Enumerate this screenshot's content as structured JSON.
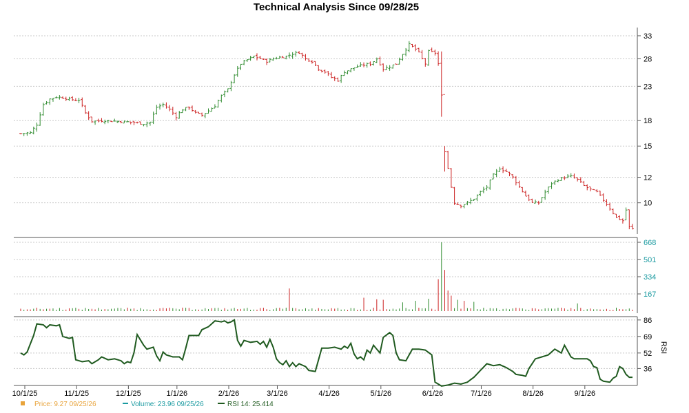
{
  "chart_data": {
    "type": "line",
    "title": "Technical Analysis Since 09/28/25",
    "colors": {
      "up": "#2e8b2e",
      "down": "#cc2222",
      "rsi": "#1f5a1f",
      "price_legend": "#e8a33a",
      "volume_legend": "#1a9aa0"
    },
    "x_tick_labels": [
      "10/1/25",
      "11/1/25",
      "12/1/25",
      "1/1/26",
      "2/1/26",
      "3/1/26",
      "4/1/26",
      "5/1/26",
      "6/1/26",
      "7/1/26",
      "8/1/26",
      "9/1/26"
    ],
    "price_panel": {
      "y_tick_labels": [
        "33",
        "28",
        "23",
        "18",
        "15",
        "12",
        "10"
      ],
      "scale": "log",
      "anchors": [
        [
          0,
          16.4
        ],
        [
          3,
          16.5
        ],
        [
          5,
          17.5
        ],
        [
          7,
          20.2
        ],
        [
          9,
          21.0
        ],
        [
          11,
          21.3
        ],
        [
          13,
          21.2
        ],
        [
          15,
          21.0
        ],
        [
          17,
          20.8
        ],
        [
          18,
          20.9
        ],
        [
          20,
          19.0
        ],
        [
          22,
          17.9
        ],
        [
          26,
          18.0
        ],
        [
          30,
          17.9
        ],
        [
          34,
          17.8
        ],
        [
          38,
          17.6
        ],
        [
          40,
          17.8
        ],
        [
          42,
          19.8
        ],
        [
          44,
          20.2
        ],
        [
          46,
          19.5
        ],
        [
          48,
          18.5
        ],
        [
          50,
          19.5
        ],
        [
          52,
          19.8
        ],
        [
          54,
          19.0
        ],
        [
          56,
          18.7
        ],
        [
          58,
          19.3
        ],
        [
          60,
          20.0
        ],
        [
          62,
          21.5
        ],
        [
          64,
          22.5
        ],
        [
          66,
          25.0
        ],
        [
          68,
          27.0
        ],
        [
          70,
          27.8
        ],
        [
          72,
          28.5
        ],
        [
          74,
          28.0
        ],
        [
          76,
          27.5
        ],
        [
          78,
          28.0
        ],
        [
          80,
          28.3
        ],
        [
          82,
          28.5
        ],
        [
          84,
          29.0
        ],
        [
          86,
          29.3
        ],
        [
          88,
          28.0
        ],
        [
          90,
          27.5
        ],
        [
          92,
          26.0
        ],
        [
          94,
          25.5
        ],
        [
          96,
          24.5
        ],
        [
          98,
          24.0
        ],
        [
          100,
          25.5
        ],
        [
          102,
          26.0
        ],
        [
          104,
          26.5
        ],
        [
          106,
          26.8
        ],
        [
          108,
          27.0
        ],
        [
          110,
          28.0
        ],
        [
          112,
          26.0
        ],
        [
          114,
          26.5
        ],
        [
          116,
          27.0
        ],
        [
          118,
          29.0
        ],
        [
          120,
          31.0
        ],
        [
          122,
          30.0
        ],
        [
          123,
          29.2
        ],
        [
          124,
          28.0
        ],
        [
          125,
          27.0
        ],
        [
          126,
          29.5
        ],
        [
          128,
          29.2
        ],
        [
          129,
          27.0
        ],
        [
          130,
          21.5
        ],
        [
          131,
          14.5
        ],
        [
          132,
          12.8
        ],
        [
          133,
          11.2
        ],
        [
          134,
          10.0
        ],
        [
          136,
          9.8
        ],
        [
          138,
          10.0
        ],
        [
          140,
          10.3
        ],
        [
          142,
          10.8
        ],
        [
          144,
          11.2
        ],
        [
          146,
          12.2
        ],
        [
          148,
          12.8
        ],
        [
          150,
          12.5
        ],
        [
          152,
          12.0
        ],
        [
          154,
          11.2
        ],
        [
          156,
          10.5
        ],
        [
          158,
          10.0
        ],
        [
          160,
          10.0
        ],
        [
          162,
          10.8
        ],
        [
          164,
          11.5
        ],
        [
          166,
          11.8
        ],
        [
          168,
          12.0
        ],
        [
          170,
          12.1
        ],
        [
          172,
          11.8
        ],
        [
          174,
          11.3
        ],
        [
          176,
          11.0
        ],
        [
          178,
          10.8
        ],
        [
          180,
          10.2
        ],
        [
          182,
          9.6
        ],
        [
          184,
          9.0
        ],
        [
          186,
          8.8
        ],
        [
          187,
          9.5
        ],
        [
          188,
          8.4
        ],
        [
          189,
          8.3
        ]
      ]
    },
    "volume_panel": {
      "y_tick_labels": [
        "668",
        "501",
        "334",
        "167"
      ],
      "max": 668,
      "spikes": [
        [
          83,
          220
        ],
        [
          106,
          130
        ],
        [
          110,
          115
        ],
        [
          112,
          110
        ],
        [
          118,
          85
        ],
        [
          122,
          100
        ],
        [
          126,
          120
        ],
        [
          129,
          310
        ],
        [
          130,
          668
        ],
        [
          131,
          400
        ],
        [
          132,
          200
        ],
        [
          133,
          150
        ],
        [
          135,
          110
        ],
        [
          137,
          100
        ],
        [
          140,
          90
        ],
        [
          172,
          75
        ]
      ]
    },
    "rsi_panel": {
      "y_tick_labels": [
        "86",
        "69",
        "52",
        "36"
      ],
      "axis_label": "RSI",
      "anchors": [
        [
          0,
          52
        ],
        [
          1,
          50
        ],
        [
          2,
          53
        ],
        [
          4,
          70
        ],
        [
          5,
          82
        ],
        [
          7,
          81
        ],
        [
          8,
          78
        ],
        [
          9,
          81
        ],
        [
          11,
          80
        ],
        [
          12,
          81
        ],
        [
          13,
          69
        ],
        [
          15,
          67
        ],
        [
          16,
          68
        ],
        [
          17,
          45
        ],
        [
          19,
          43
        ],
        [
          21,
          44
        ],
        [
          22,
          41
        ],
        [
          24,
          45
        ],
        [
          25,
          48
        ],
        [
          27,
          45
        ],
        [
          29,
          46
        ],
        [
          31,
          44
        ],
        [
          32,
          41
        ],
        [
          33,
          43
        ],
        [
          34,
          42
        ],
        [
          35,
          52
        ],
        [
          36,
          71
        ],
        [
          38,
          60
        ],
        [
          39,
          56
        ],
        [
          41,
          58
        ],
        [
          42,
          49
        ],
        [
          43,
          44
        ],
        [
          44,
          53
        ],
        [
          45,
          50
        ],
        [
          47,
          48
        ],
        [
          49,
          48
        ],
        [
          50,
          45
        ],
        [
          51,
          57
        ],
        [
          52,
          70
        ],
        [
          54,
          70
        ],
        [
          55,
          70
        ],
        [
          56,
          76
        ],
        [
          58,
          79
        ],
        [
          60,
          85
        ],
        [
          62,
          84
        ],
        [
          63,
          85
        ],
        [
          64,
          83
        ],
        [
          65,
          84
        ],
        [
          66,
          86
        ],
        [
          67,
          65
        ],
        [
          68,
          59
        ],
        [
          69,
          65
        ],
        [
          71,
          63
        ],
        [
          73,
          64
        ],
        [
          74,
          61
        ],
        [
          75,
          64
        ],
        [
          76,
          58
        ],
        [
          77,
          66
        ],
        [
          78,
          58
        ],
        [
          79,
          46
        ],
        [
          80,
          42
        ],
        [
          81,
          40
        ],
        [
          82,
          44
        ],
        [
          83,
          38
        ],
        [
          84,
          42
        ],
        [
          85,
          38
        ],
        [
          86,
          41
        ],
        [
          88,
          38
        ],
        [
          89,
          34
        ],
        [
          91,
          33
        ],
        [
          93,
          57
        ],
        [
          95,
          57
        ],
        [
          97,
          58
        ],
        [
          99,
          56
        ],
        [
          100,
          59
        ],
        [
          101,
          57
        ],
        [
          102,
          62
        ],
        [
          103,
          51
        ],
        [
          104,
          46
        ],
        [
          105,
          48
        ],
        [
          106,
          45
        ],
        [
          107,
          55
        ],
        [
          108,
          52
        ],
        [
          109,
          60
        ],
        [
          111,
          52
        ],
        [
          112,
          68
        ],
        [
          114,
          73
        ],
        [
          115,
          70
        ],
        [
          116,
          52
        ],
        [
          117,
          45
        ],
        [
          119,
          44
        ],
        [
          121,
          56
        ],
        [
          123,
          56
        ],
        [
          125,
          55
        ],
        [
          127,
          50
        ],
        [
          128,
          22
        ],
        [
          130,
          18
        ],
        [
          132,
          19
        ],
        [
          134,
          21
        ],
        [
          136,
          20
        ],
        [
          138,
          22
        ],
        [
          140,
          27
        ],
        [
          142,
          34
        ],
        [
          144,
          41
        ],
        [
          146,
          39
        ],
        [
          148,
          40
        ],
        [
          150,
          37
        ],
        [
          152,
          33
        ],
        [
          153,
          30
        ],
        [
          155,
          29
        ],
        [
          156,
          28
        ],
        [
          157,
          36
        ],
        [
          159,
          46
        ],
        [
          161,
          48
        ],
        [
          163,
          50
        ],
        [
          165,
          56
        ],
        [
          167,
          52
        ],
        [
          168,
          60
        ],
        [
          170,
          48
        ],
        [
          171,
          46
        ],
        [
          173,
          46
        ],
        [
          175,
          46
        ],
        [
          176,
          44
        ],
        [
          177,
          38
        ],
        [
          178,
          37
        ],
        [
          179,
          25
        ],
        [
          180,
          23
        ],
        [
          182,
          22
        ],
        [
          183,
          26
        ],
        [
          184,
          28
        ],
        [
          185,
          38
        ],
        [
          186,
          36
        ],
        [
          187,
          30
        ],
        [
          188,
          27
        ]
      ]
    },
    "legend": {
      "price_text": "Price: 9.27  09/25/26",
      "volume_text": "Volume: 23.96  09/25/26",
      "rsi_text": "RSI 14: 25.414"
    }
  }
}
